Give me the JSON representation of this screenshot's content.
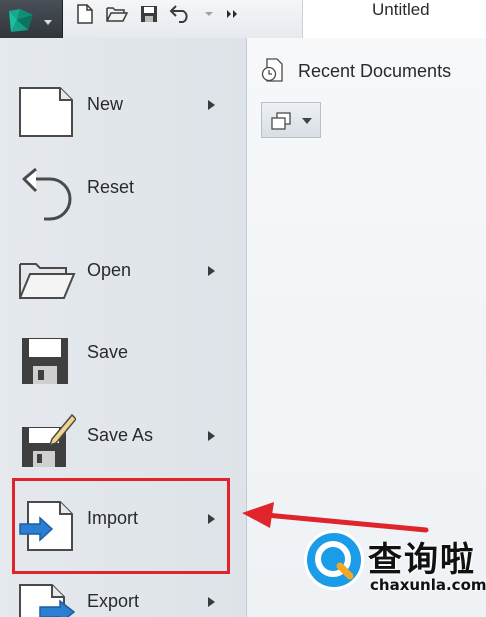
{
  "window": {
    "title": "Untitled"
  },
  "quick_access": {
    "buttons": [
      {
        "icon": "new-document-icon"
      },
      {
        "icon": "open-folder-icon"
      },
      {
        "icon": "save-icon"
      },
      {
        "icon": "undo-icon"
      },
      {
        "icon": "dropdown-arrow-icon"
      },
      {
        "icon": "more-icon"
      }
    ]
  },
  "menu": {
    "items": [
      {
        "label": "New",
        "icon": "new-document-icon",
        "has_submenu": true
      },
      {
        "label": "Reset",
        "icon": "reset-icon",
        "has_submenu": false
      },
      {
        "label": "Open",
        "icon": "open-folder-icon",
        "has_submenu": true
      },
      {
        "label": "Save",
        "icon": "save-icon",
        "has_submenu": false
      },
      {
        "label": "Save As",
        "icon": "save-as-icon",
        "has_submenu": true
      },
      {
        "label": "Import",
        "icon": "import-icon",
        "has_submenu": true,
        "highlighted": true
      },
      {
        "label": "Export",
        "icon": "export-icon",
        "has_submenu": true
      }
    ]
  },
  "recent": {
    "label": "Recent Documents",
    "icon": "recent-documents-icon",
    "view_dropdown_icon": "view-options-icon"
  },
  "annotation": {
    "color": "#e0242c"
  },
  "watermark": {
    "text_cn": "查询啦",
    "text_en": "chaxunla.com"
  }
}
